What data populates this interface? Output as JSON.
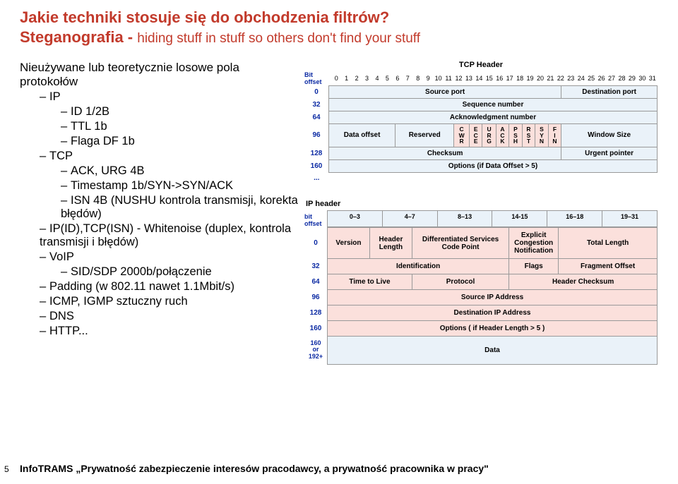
{
  "title": "Jakie techniki stosuje się do obchodzenia filtrów?",
  "subtitle_prefix": "Steganografia - ",
  "subtitle_hiding": "hiding stuff in stuff so others don't find your stuff",
  "sect_heading": "Nieużywane lub teoretycznie losowe pola protokołów",
  "bullets": {
    "ip": "IP",
    "ip_id": "ID 1/2B",
    "ip_ttl": "TTL 1b",
    "ip_df": "Flaga DF 1b",
    "tcp": "TCP",
    "tcp_ack": "ACK, URG 4B",
    "tcp_ts": "Timestamp 1b/SYN->SYN/ACK",
    "tcp_isn": "ISN 4B (NUSHU kontrola transmisji, korekta błędów)",
    "ipid": "IP(ID),TCP(ISN) - Whitenoise (duplex, kontrola transmisji i błędów)",
    "voip": "VoIP",
    "voip_sid": "SID/SDP 2000b/połączenie",
    "padding": "Padding (w 802.11 nawet 1.1Mbit/s)",
    "icmp": "ICMP, IGMP sztuczny ruch",
    "dns": "DNS",
    "http": "HTTP..."
  },
  "tcp_header": {
    "title": "TCP Header",
    "bit_offset": "Bit offset",
    "bits": [
      "0",
      "1",
      "2",
      "3",
      "4",
      "5",
      "6",
      "7",
      "8",
      "9",
      "10",
      "11",
      "12",
      "13",
      "14",
      "15",
      "16",
      "17",
      "18",
      "19",
      "20",
      "21",
      "22",
      "23",
      "24",
      "25",
      "26",
      "27",
      "28",
      "29",
      "30",
      "31"
    ],
    "r0": "0",
    "src": "Source port",
    "dst": "Destination port",
    "r32": "32",
    "seq": "Sequence number",
    "r64": "64",
    "ack": "Acknowledgment number",
    "r96": "96",
    "doff": "Data offset",
    "resv": "Reserved",
    "flags": [
      "C\nW\nR",
      "E\nC\nE",
      "U\nR\nG",
      "A\nC\nK",
      "P\nS\nH",
      "R\nS\nT",
      "S\nY\nN",
      "F\nI\nN"
    ],
    "win": "Window Size",
    "r128": "128",
    "cksum": "Checksum",
    "urg": "Urgent pointer",
    "r160": "160",
    "opt": "Options (if Data Offset > 5)",
    "rdots": "..."
  },
  "ip_header": {
    "title": "IP header",
    "blabel": "bit\noffset",
    "bits": [
      "0–3",
      "4–7",
      "8–13",
      "14-15",
      "16–18",
      "19–31"
    ],
    "r0": "0",
    "ver": "Version",
    "hlen": "Header Length",
    "dscp": "Differentiated Services Code Point",
    "ecn": "Explicit Congestion Notification",
    "tlen": "Total Length",
    "r32": "32",
    "ident": "Identification",
    "flags": "Flags",
    "frag": "Fragment Offset",
    "r64": "64",
    "ttl": "Time to Live",
    "proto": "Protocol",
    "hphead": "Header Checksum",
    "r96": "96",
    "src": "Source IP Address",
    "r128": "128",
    "dst": "Destination IP Address",
    "r160": "160",
    "opt": "Options ( if Header Length > 5 )",
    "r160b": "160\nor\n192+",
    "data": "Data"
  },
  "footer": {
    "page_num": "5",
    "text": "InfoTRAMS „Prywatność zabezpieczenie interesów pracodawcy, a prywatność pracownika w pracy\""
  }
}
